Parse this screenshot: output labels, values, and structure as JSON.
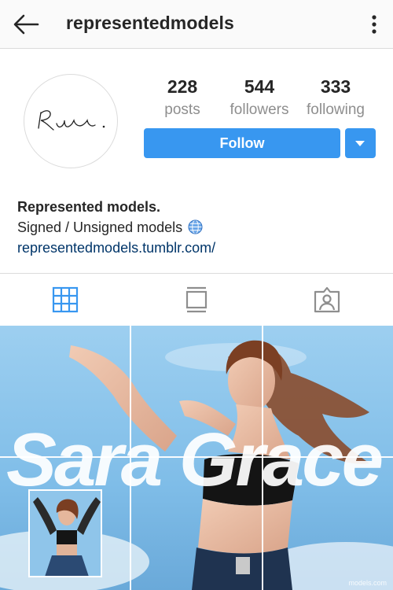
{
  "header": {
    "username": "representedmodels",
    "back_icon": "arrow-left-icon",
    "more_icon": "more-vertical-icon"
  },
  "profile": {
    "avatar_signature": "Ru.",
    "stats": [
      {
        "value": "228",
        "label": "posts"
      },
      {
        "value": "544",
        "label": "followers"
      },
      {
        "value": "333",
        "label": "following"
      }
    ],
    "follow_label": "Follow",
    "accent_color": "#3897f0"
  },
  "bio": {
    "name": "Represented models.",
    "description": "Signed / Unsigned models",
    "link": "representedmodels.tumblr.com/"
  },
  "tabs": [
    {
      "icon": "grid-icon",
      "active": true
    },
    {
      "icon": "feed-icon",
      "active": false
    },
    {
      "icon": "tagged-icon",
      "active": false
    }
  ],
  "post": {
    "overlay_text": "Sara Grace",
    "watermark": "models.com"
  }
}
